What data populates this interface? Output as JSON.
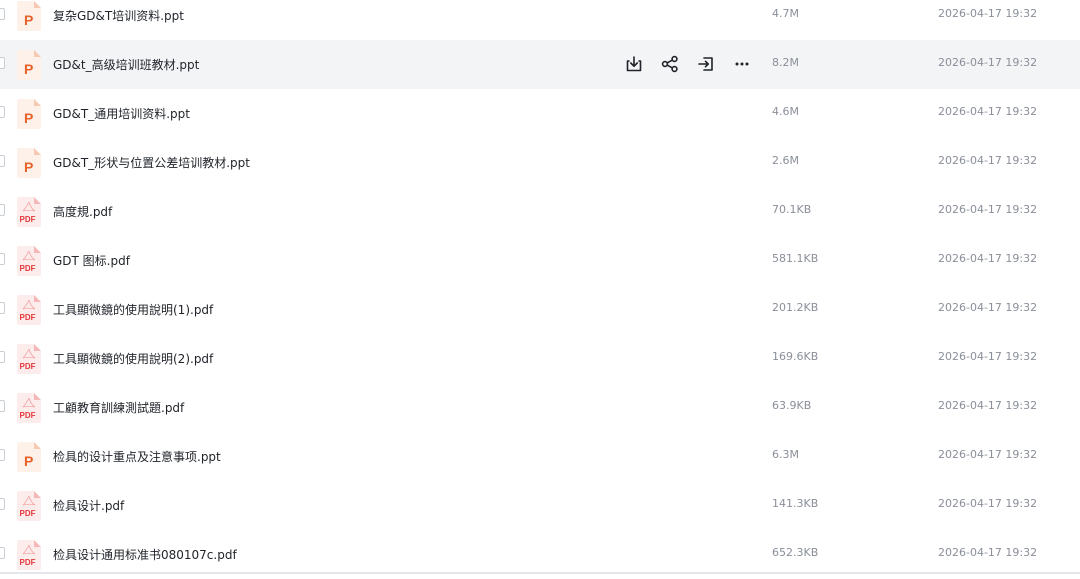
{
  "colors": {
    "ppt_orange": "#e8622a",
    "pdf_red": "#e3393c",
    "row_hover": "#f3f4f6",
    "text_primary": "#1f2329",
    "text_secondary": "#8a8f99"
  },
  "row_actions": {
    "download_icon": "download-icon",
    "share_icon": "share-icon",
    "move_icon": "move-icon",
    "more_icon": "more-icon"
  },
  "files": [
    {
      "name": "复杂GD&T培训资料.ppt",
      "type": "ppt",
      "icon_letter": "P",
      "size": "4.7M",
      "date": "2026-04-17 19:32"
    },
    {
      "name": "GD&t_高级培训班教材.ppt",
      "type": "ppt",
      "icon_letter": "P",
      "size": "8.2M",
      "date": "2026-04-17 19:32"
    },
    {
      "name": "GD&T_通用培训资料.ppt",
      "type": "ppt",
      "icon_letter": "P",
      "size": "4.6M",
      "date": "2026-04-17 19:32"
    },
    {
      "name": "GD&T_形状与位置公差培训教材.ppt",
      "type": "ppt",
      "icon_letter": "P",
      "size": "2.6M",
      "date": "2026-04-17 19:32"
    },
    {
      "name": "高度規.pdf",
      "type": "pdf",
      "icon_letter": "PDF",
      "size": "70.1KB",
      "date": "2026-04-17 19:32"
    },
    {
      "name": "GDT 图标.pdf",
      "type": "pdf",
      "icon_letter": "PDF",
      "size": "581.1KB",
      "date": "2026-04-17 19:32"
    },
    {
      "name": "工具顯微鏡的使用說明(1).pdf",
      "type": "pdf",
      "icon_letter": "PDF",
      "size": "201.2KB",
      "date": "2026-04-17 19:32"
    },
    {
      "name": "工具顯微鏡的使用說明(2).pdf",
      "type": "pdf",
      "icon_letter": "PDF",
      "size": "169.6KB",
      "date": "2026-04-17 19:32"
    },
    {
      "name": "工顧教育訓練測試題.pdf",
      "type": "pdf",
      "icon_letter": "PDF",
      "size": "63.9KB",
      "date": "2026-04-17 19:32"
    },
    {
      "name": "检具的设计重点及注意事项.ppt",
      "type": "ppt",
      "icon_letter": "P",
      "size": "6.3M",
      "date": "2026-04-17 19:32"
    },
    {
      "name": "检具设计.pdf",
      "type": "pdf",
      "icon_letter": "PDF",
      "size": "141.3KB",
      "date": "2026-04-17 19:32"
    },
    {
      "name": "检具设计通用标准书080107c.pdf",
      "type": "pdf",
      "icon_letter": "PDF",
      "size": "652.3KB",
      "date": "2026-04-17 19:32"
    }
  ],
  "hovered_row": 1
}
